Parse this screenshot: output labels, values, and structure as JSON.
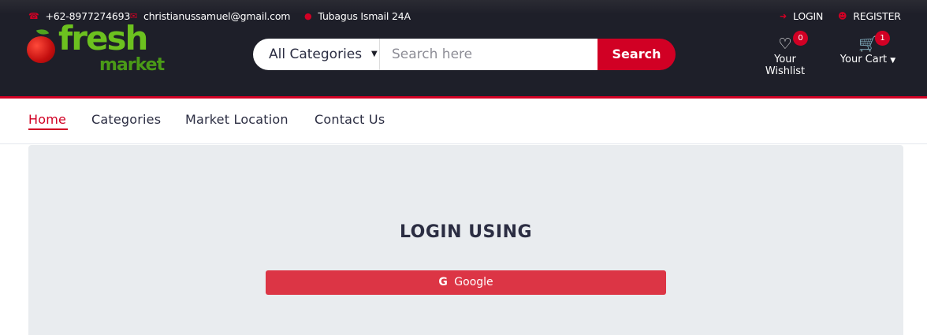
{
  "topbar": {
    "phone": "+62-8977274693",
    "email": "christianussamuel@gmail.com",
    "address": "Tubagus Ismail 24A",
    "login_label": "LOGIN",
    "register_label": "REGISTER"
  },
  "logo": {
    "word1": "fresh",
    "word2": "market"
  },
  "search": {
    "category_selected": "All Categories",
    "placeholder": "Search here",
    "button_label": "Search"
  },
  "header_links": {
    "wishlist_label": "Your Wishlist",
    "wishlist_count": "0",
    "cart_label": "Your Cart",
    "cart_count": "1"
  },
  "nav": {
    "items": [
      "Home",
      "Categories",
      "Market Location",
      "Contact Us"
    ],
    "active": "Home"
  },
  "login": {
    "title": "LOGIN USING",
    "google_label": "Google"
  },
  "colors": {
    "header_bg": "#1e1f29",
    "accent": "#d10024",
    "button_red": "#dc3545",
    "panel_bg": "#e9ecef",
    "logo_green": "#6cc11f"
  }
}
